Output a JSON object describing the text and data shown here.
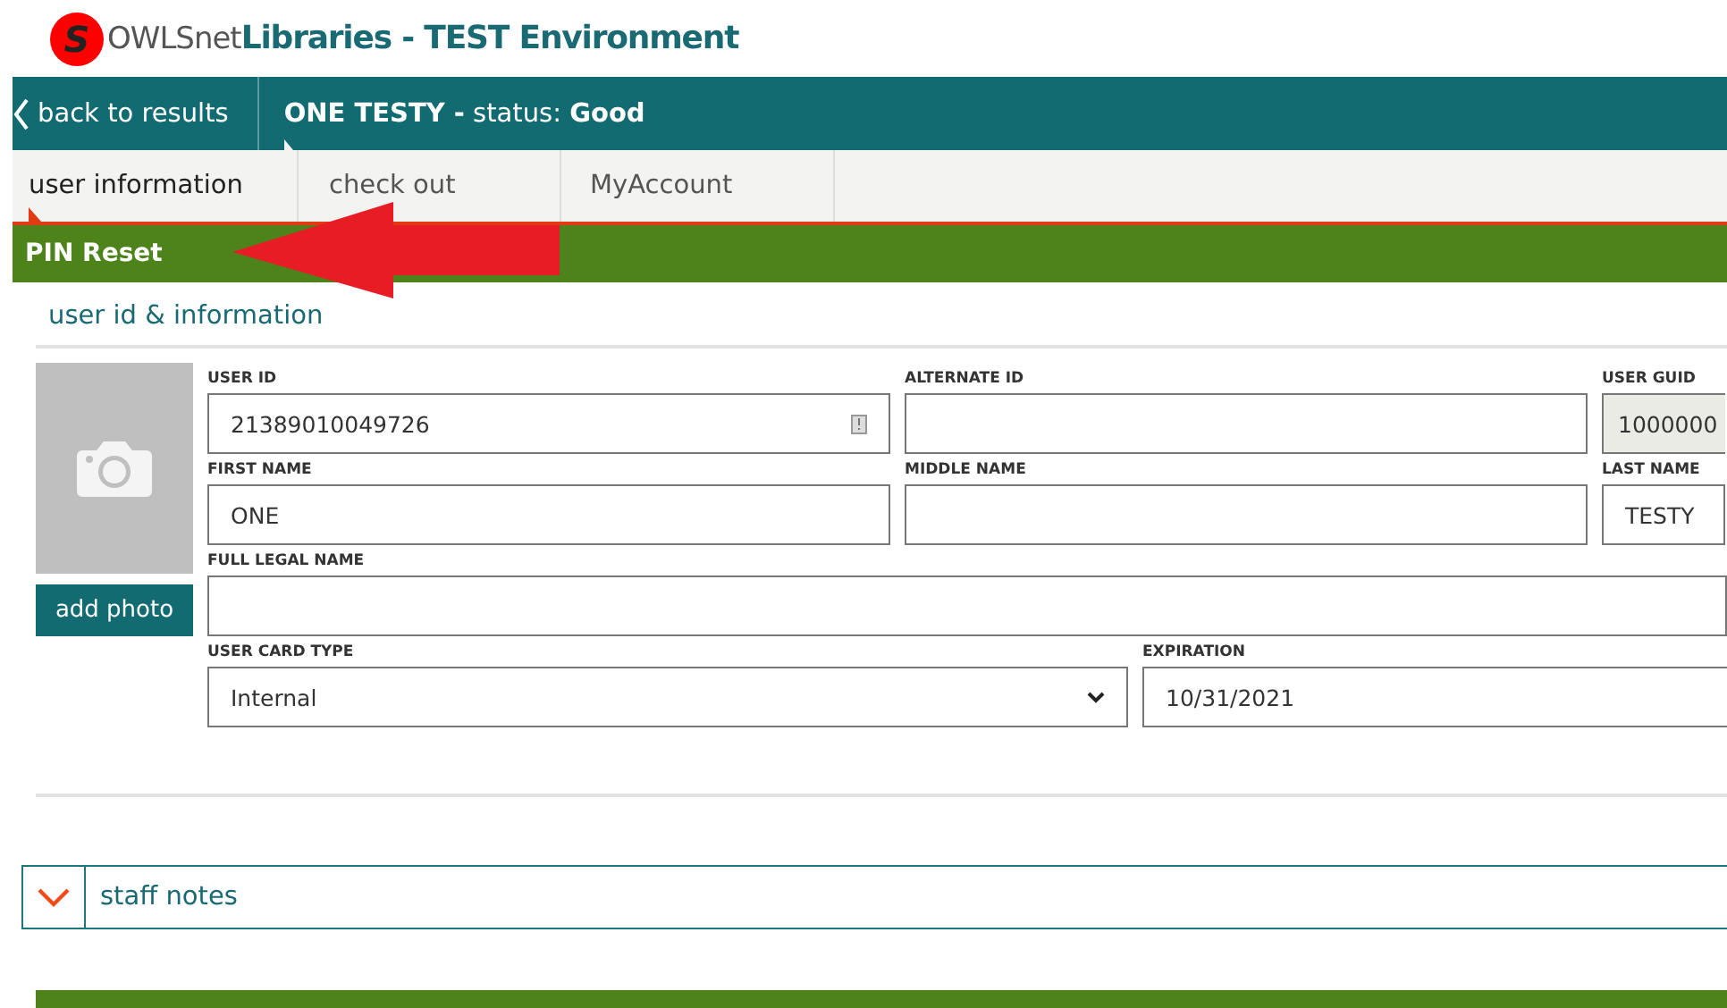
{
  "header": {
    "logo_letter": "S",
    "brand_prefix": "OWLSnet",
    "brand_name": "Libraries - TEST Environment"
  },
  "nav": {
    "back": "back to results",
    "patron": "**ONE TESTY -** status: **Good**"
  },
  "tabs": [
    {
      "label": "user information",
      "selected": true
    },
    {
      "label": "check out",
      "selected": false
    },
    {
      "label": "MyAccount",
      "selected": false
    }
  ],
  "action_bar": {
    "label": "PIN Reset"
  },
  "section": {
    "title": "user id & information",
    "add_photo": "add photo"
  },
  "field_rows": [
    [
      {
        "kind": "id",
        "label": "USER ID",
        "value": "21389010049726",
        "readonly": false
      },
      {
        "kind": "text",
        "label": "ALTERNATE ID",
        "readonly": false
      },
      {
        "kind": "text",
        "label": "USER GUID",
        "value": "1000000",
        "readonly": true
      }
    ],
    [
      {
        "kind": "text",
        "label": "FIRST NAME",
        "value": "ONE",
        "readonly": false
      },
      {
        "kind": "text",
        "label": "MIDDLE NAME",
        "readonly": false
      },
      {
        "kind": "text",
        "label": "LAST NAME",
        "value": "TESTY",
        "readonly": false
      }
    ],
    [
      {
        "kind": "text",
        "label": "FULL LEGAL NAME",
        "readonly": false
      }
    ],
    [
      {
        "kind": "select",
        "label": "USER CARD TYPE",
        "value": "Internal",
        "readonly": false
      },
      {
        "kind": "text",
        "label": "EXPIRATION",
        "value": "10/31/2021",
        "readonly": false
      }
    ]
  ],
  "staff_notes": {
    "label": "staff notes",
    "expanded": false
  }
}
